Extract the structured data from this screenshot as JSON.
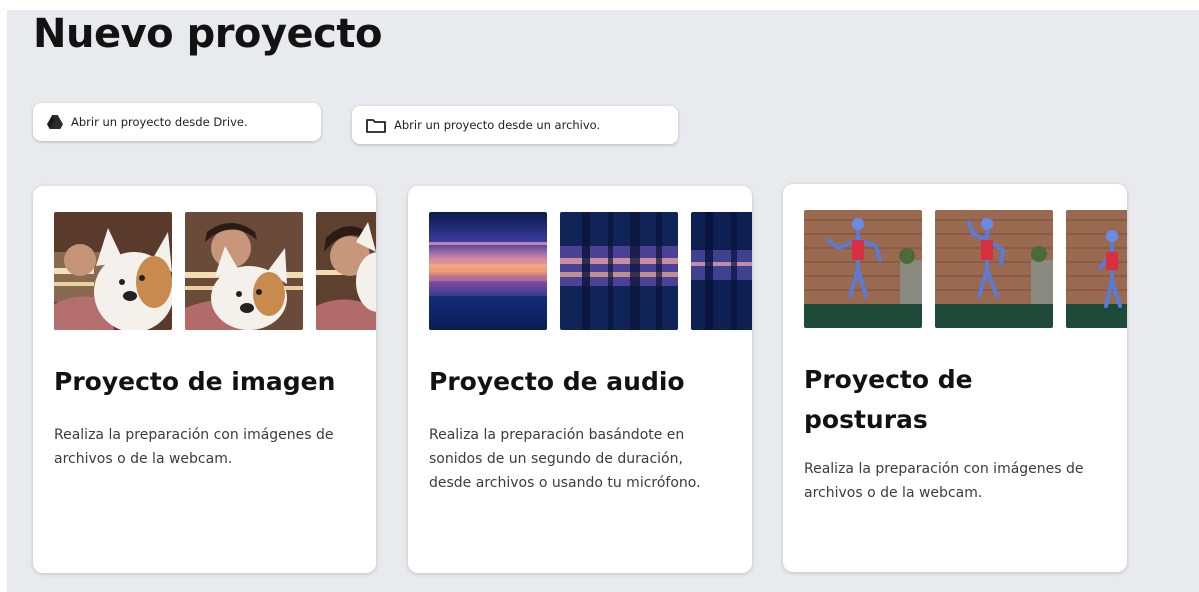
{
  "page": {
    "title": "Nuevo proyecto"
  },
  "actions": {
    "drive_label": "Abrir un proyecto desde Drive.",
    "file_label": "Abrir un proyecto desde un archivo."
  },
  "cards": [
    {
      "title": "Proyecto de imagen",
      "description": "Realiza la preparación con imágenes de archivos o de la webcam.",
      "thumbnails": [
        "corgi-plush-photo",
        "corgi-plush-photo",
        "corgi-plush-photo"
      ]
    },
    {
      "title": "Proyecto de audio",
      "description": "Realiza la preparación basándote en sonidos de un segundo de duración, desde archivos o usando tu micrófono.",
      "thumbnails": [
        "spectrogram",
        "spectrogram",
        "spectrogram"
      ]
    },
    {
      "title": "Proyecto de posturas",
      "description": "Realiza la preparación con imágenes de archivos o de la webcam.",
      "thumbnails": [
        "pose-skeleton-photo",
        "pose-skeleton-photo",
        "pose-skeleton-photo"
      ]
    }
  ],
  "icons": {
    "drive": "drive-icon",
    "folder": "folder-icon"
  },
  "colors": {
    "background": "#e9eaed",
    "card": "#ffffff",
    "text": "#121212"
  }
}
